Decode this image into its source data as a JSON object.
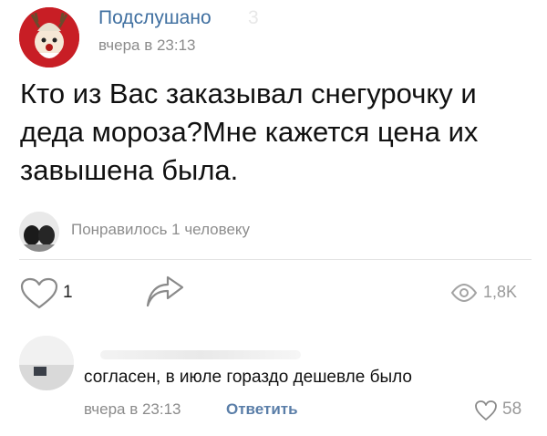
{
  "post": {
    "group_name": "Подслушано",
    "time": "вчера в 23:13",
    "text": "Кто из Вас заказывал снегурочку и деда мороза?Мне кажется цена их завышена была.",
    "liked_by": "Понравилось 1 человеку",
    "likes": "1",
    "views": "1,8K"
  },
  "comment": {
    "text": "согласен, в июле гораздо дешевле было",
    "time": "вчера в 23:13",
    "reply_label": "Ответить",
    "likes": "58"
  },
  "colors": {
    "group_link": "#3f6fa0",
    "reply_link": "#5a7ea8",
    "muted_text": "#8b8b8b",
    "avatar_red": "#c81e25"
  },
  "icons": [
    "heart-outline-icon",
    "share-arrow-icon",
    "eye-icon"
  ]
}
